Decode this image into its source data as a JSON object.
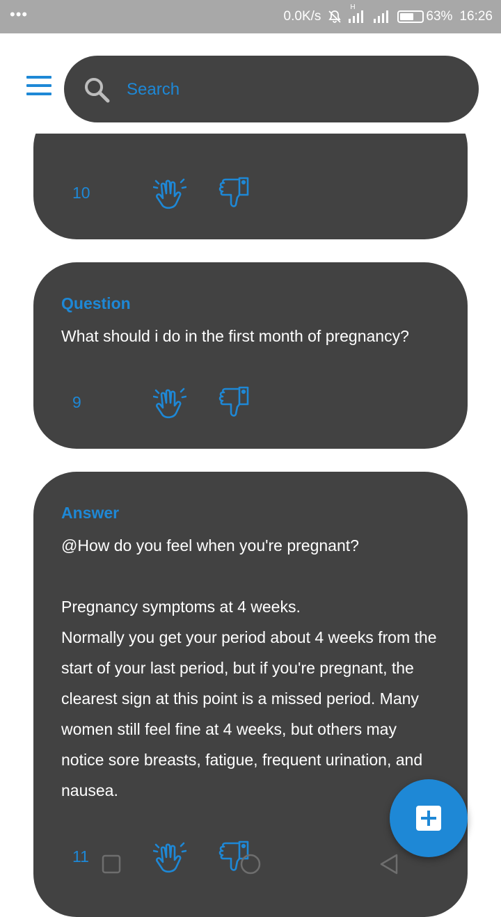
{
  "status_bar": {
    "network_speed": "0.0K/s",
    "battery_percent": "63%",
    "battery_level": 0.63,
    "time": "16:26",
    "network_type": "H"
  },
  "search": {
    "placeholder": "Search"
  },
  "feed": [
    {
      "count": "10"
    },
    {
      "kind": "Question",
      "text": "What should i do in the first month of pregnancy?",
      "count": "9"
    },
    {
      "kind": "Answer",
      "text": "@How do you feel when you're pregnant?\n\nPregnancy symptoms at 4 weeks.\nNormally you get your period about 4 weeks from the start of your last period, but if you're pregnant, the clearest sign at this point is a missed period. Many women still feel fine at 4 weeks, but others may notice sore breasts, fatigue, frequent urination, and nausea.",
      "count": "11"
    }
  ],
  "colors": {
    "accent": "#1e88d6",
    "card": "#424242",
    "status_bar": "#a8a8a8"
  }
}
